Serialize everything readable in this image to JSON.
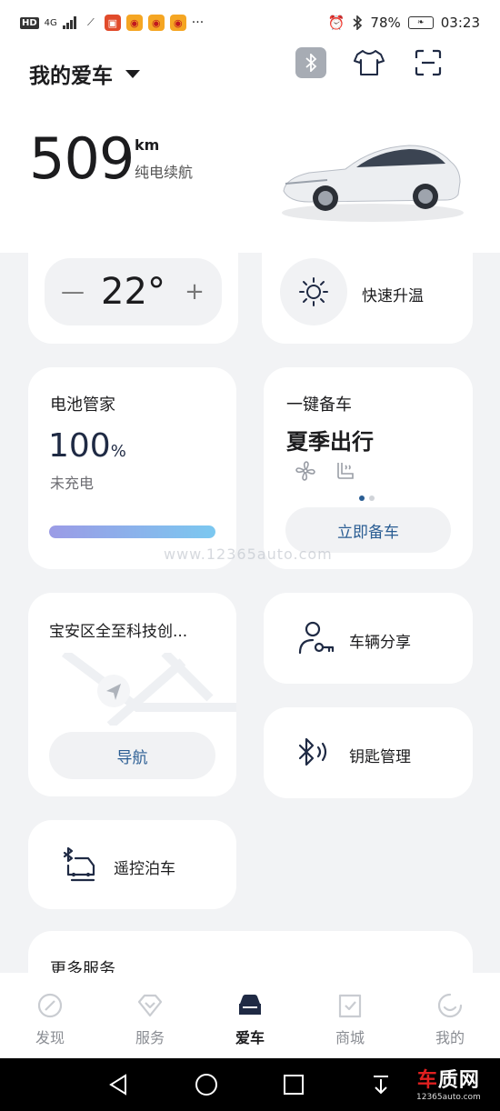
{
  "status_bar": {
    "left_badges": [
      "HD",
      "4G"
    ],
    "more": "···",
    "battery_percent": "78%",
    "time": "03:23"
  },
  "header": {
    "title": "我的爱车",
    "range_value": "509",
    "range_unit": "km",
    "range_label": "纯电续航"
  },
  "climate": {
    "minus": "—",
    "temperature": "22°",
    "plus": "+",
    "quick_heat_label": "快速升温"
  },
  "battery": {
    "title": "电池管家",
    "value": "100",
    "unit": "%",
    "status": "未充电",
    "level_fraction": 1.0
  },
  "prep": {
    "title": "一键备车",
    "mode": "夏季出行",
    "button": "立即备车",
    "page_count": 2,
    "active_page": 1
  },
  "watermark": "www.12365auto.com",
  "navigation": {
    "address": "宝安区全至科技创...",
    "button": "导航"
  },
  "share": {
    "label": "车辆分享"
  },
  "keys": {
    "label": "钥匙管理"
  },
  "parking": {
    "label": "遥控泊车"
  },
  "more_services": {
    "title": "更多服务"
  },
  "tabs": [
    {
      "label": "发现",
      "icon": "compass-icon",
      "active": false
    },
    {
      "label": "服务",
      "icon": "heart-diamond-icon",
      "active": false
    },
    {
      "label": "爱车",
      "icon": "car-icon",
      "active": true
    },
    {
      "label": "商城",
      "icon": "shopping-bag-icon",
      "active": false
    },
    {
      "label": "我的",
      "icon": "smile-icon",
      "active": false
    }
  ],
  "brand": {
    "name_a": "车",
    "name_b": "质网",
    "url": "12365auto.com"
  },
  "colors": {
    "accent": "#2a5d93",
    "battery_gradient": [
      "#9b9be6",
      "#7bc8f0"
    ],
    "background": "#f2f3f5"
  }
}
